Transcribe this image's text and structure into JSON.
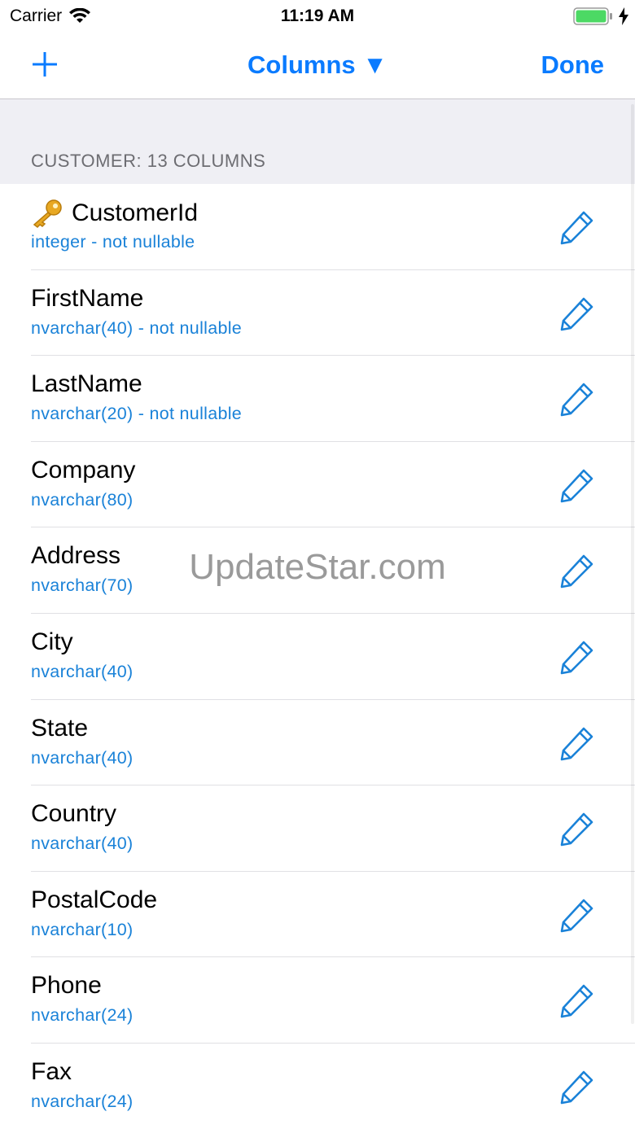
{
  "status_bar": {
    "carrier": "Carrier",
    "time": "11:19 AM",
    "battery_color": "#4cd964"
  },
  "nav": {
    "add_icon": "plus-icon",
    "title": "Columns ▼",
    "done": "Done",
    "accent_color": "#0a7bff"
  },
  "section": {
    "header": "CUSTOMER: 13 COLUMNS"
  },
  "columns": [
    {
      "name": "CustomerId",
      "type": "integer - not nullable",
      "primary_key": true
    },
    {
      "name": "FirstName",
      "type": "nvarchar(40) - not nullable"
    },
    {
      "name": "LastName",
      "type": "nvarchar(20) - not nullable"
    },
    {
      "name": "Company",
      "type": "nvarchar(80)"
    },
    {
      "name": "Address",
      "type": "nvarchar(70)"
    },
    {
      "name": "City",
      "type": "nvarchar(40)"
    },
    {
      "name": "State",
      "type": "nvarchar(40)"
    },
    {
      "name": "Country",
      "type": "nvarchar(40)"
    },
    {
      "name": "PostalCode",
      "type": "nvarchar(10)"
    },
    {
      "name": "Phone",
      "type": "nvarchar(24)"
    },
    {
      "name": "Fax",
      "type": "nvarchar(24)"
    }
  ],
  "watermark": "UpdateStar.com"
}
